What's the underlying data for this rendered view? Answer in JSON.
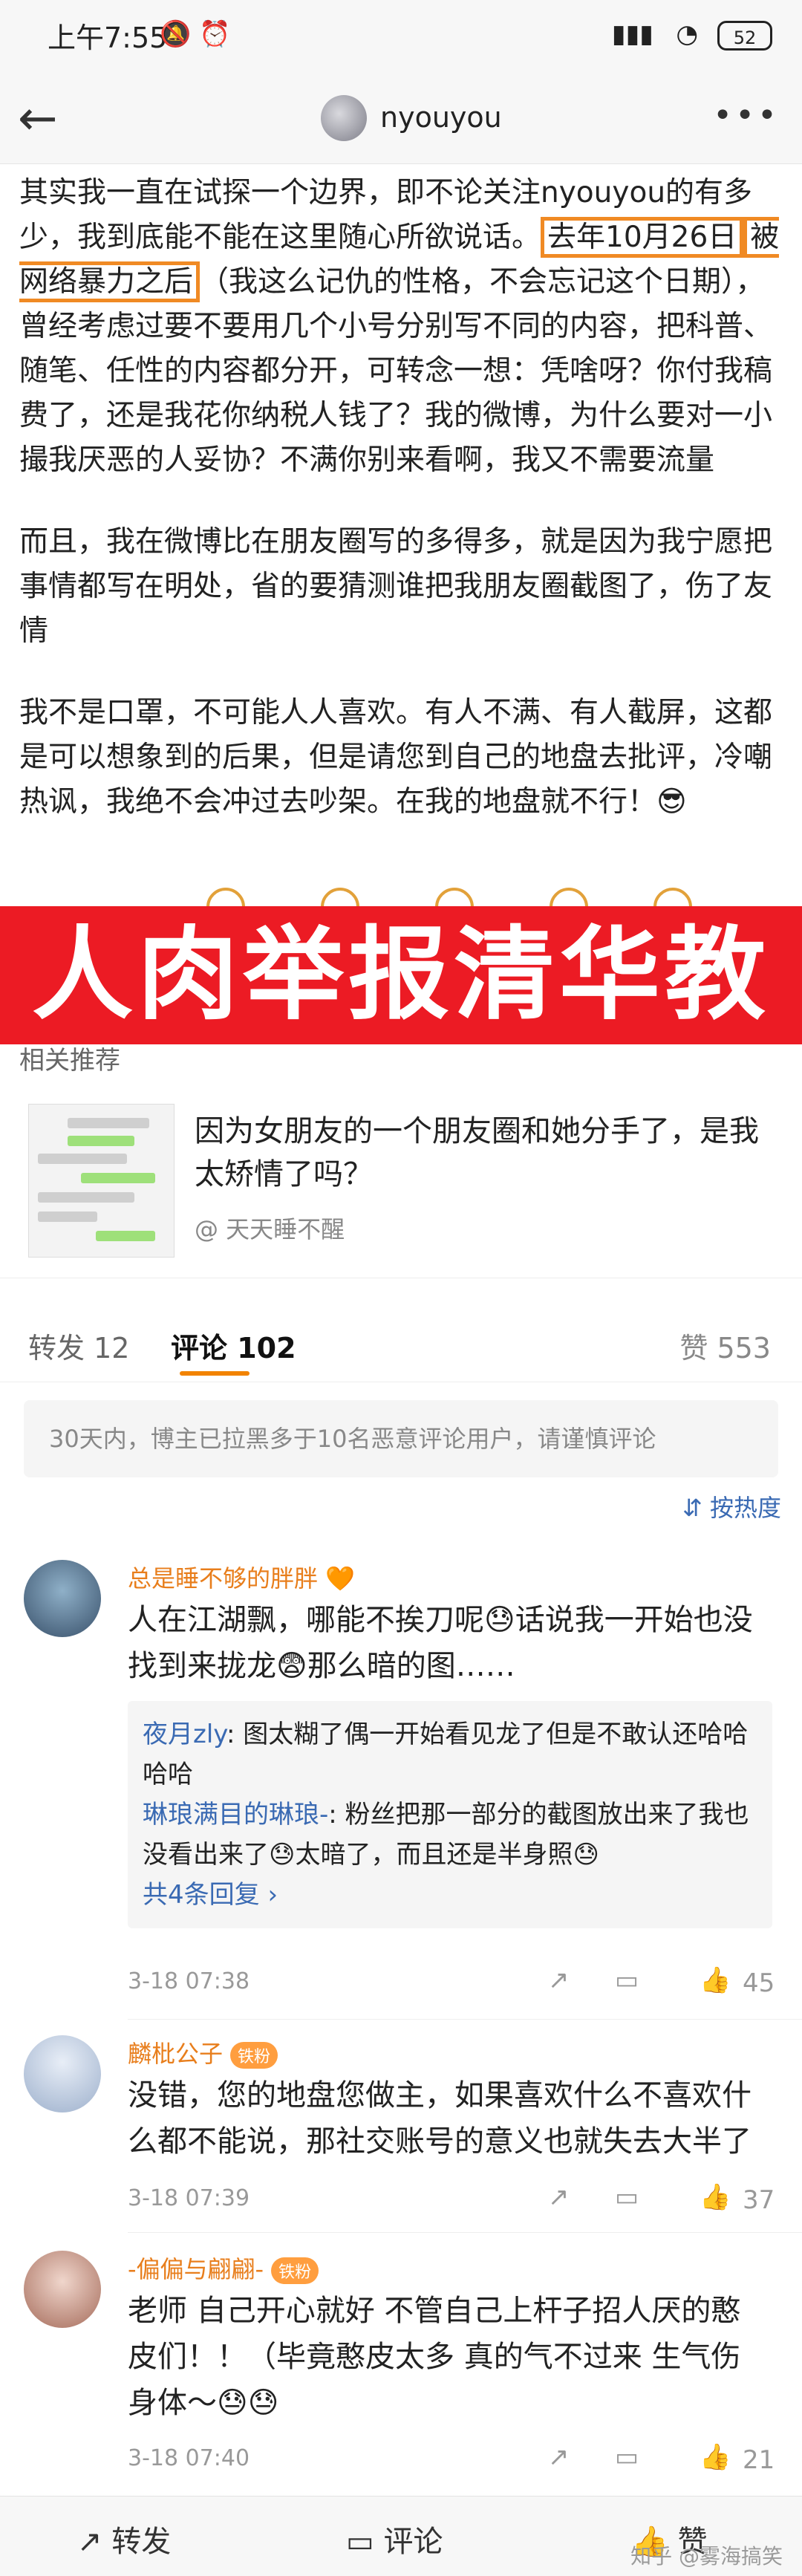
{
  "status_bar": {
    "time": "上午7:55",
    "battery": "52"
  },
  "nav": {
    "title": "nyouyou"
  },
  "post": {
    "p1_a": "其实我一直在试探一个边界，即不论关注nyouyou的有多少，我到底能不能在这里随心所欲说话。",
    "p1_highlight_1": "去年10月26日",
    "p1_highlight_2": "被网络暴力之后",
    "p1_b": "（我这么记仇的性格，不会忘记这个日期），曾经考虑过要不要用几个小号分别写不同的内容，把科普、随笔、任性的内容都分开，可转念一想：凭啥呀？你付我稿费了，还是我花你纳税人钱了？我的微博，为什么要对一小撮我厌恶的人妥协？不满你别来看啊，我又不需要流量",
    "p2": "而且，我在微博比在朋友圈写的多得多，就是因为我宁愿把事情都写在明处，省的要猜测谁把我朋友圈截图了，伤了友情",
    "p3": "我不是口罩，不可能人人喜欢。有人不满、有人截屏，这都是可以想象到的后果，但是请您到自己的地盘去批评，冷嘲热讽，我绝不会冲过去吵架。在我的地盘就不行！😎"
  },
  "banner": {
    "text": "人肉举报清华教授"
  },
  "related": {
    "label": "相关推荐",
    "title": "因为女朋友的一个朋友圈和她分手了，是我太矫情了吗？",
    "source": "@ 天天睡不醒"
  },
  "tabs": {
    "repost": "转发 12",
    "comments": "评论 102",
    "likes": "赞 553"
  },
  "notice": "30天内，博主已拉黑多于10名恶意评论用户，请谨慎评论",
  "sort_label": "按热度",
  "comments": [
    {
      "name": "总是睡不够的胖胖",
      "badge": "",
      "text": "人在江湖飘，哪能不挨刀呢😓话说我一开始也没找到来拢龙😨那么暗的图……",
      "replies": [
        {
          "name": "夜月zly",
          "text": ": 图太糊了偶一开始看见龙了但是不敢认还哈哈哈哈"
        },
        {
          "name": "琳琅满目的琳琅-",
          "text": ": 粉丝把那一部分的截图放出来了我也没看出来了😓太暗了，而且还是半身照😓"
        }
      ],
      "more": "共4条回复 ›",
      "time": "3-18 07:38",
      "likes": "45"
    },
    {
      "name": "麟枇公子",
      "badge": "铁粉",
      "text": "没错，您的地盘您做主，如果喜欢什么不喜欢什么都不能说，那社交账号的意义也就失去大半了",
      "time": "3-18 07:39",
      "likes": "37"
    },
    {
      "name": "-偏偏与翩翩-",
      "badge": "铁粉",
      "text": "老师 自己开心就好 不管自己上杆子招人厌的憨皮们！！（毕竟憨皮太多 真的气不过来 生气伤身体～😓😓",
      "time": "3-18 07:40",
      "likes": "21"
    }
  ],
  "bottom_bar": {
    "repost": "转发",
    "comment": "评论",
    "like": "赞"
  },
  "watermark": "知乎 @雾海搞笑",
  "colors": {
    "banner_red": "#ec1b24",
    "highlight": "#f08a24",
    "link_blue": "#3a6ab3",
    "name_orange": "#e87e1c"
  }
}
